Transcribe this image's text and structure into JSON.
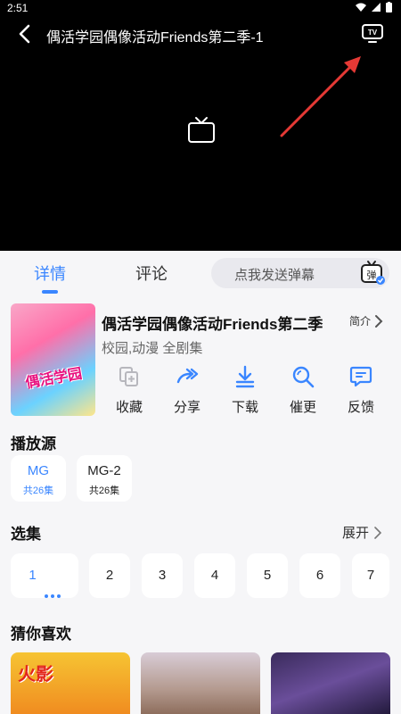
{
  "status_bar": {
    "time": "2:51"
  },
  "player": {
    "title": "偶活学园偶像活动Friends第二季-1"
  },
  "tabs": {
    "details": "详情",
    "comments": "评论"
  },
  "danmaku": {
    "placeholder": "点我发送弹幕",
    "icon_label": "弹"
  },
  "show": {
    "title": "偶活学园偶像活动Friends第二季",
    "intro_label": "简介",
    "tags": "校园,动漫 全剧集",
    "cover_text": "偶活学园"
  },
  "actions": {
    "favorite": "收藏",
    "share": "分享",
    "download": "下载",
    "rush": "催更",
    "feedback": "反馈"
  },
  "sources": {
    "title": "播放源",
    "items": [
      {
        "name": "MG",
        "count": "共26集"
      },
      {
        "name": "MG-2",
        "count": "共26集"
      }
    ]
  },
  "episodes": {
    "title": "选集",
    "expand_label": "展开",
    "items": [
      "1",
      "2",
      "3",
      "4",
      "5",
      "6",
      "7"
    ]
  },
  "recommendations": {
    "title": "猜你喜欢"
  },
  "colors": {
    "accent": "#3a86ff",
    "arrow": "#e53935"
  }
}
